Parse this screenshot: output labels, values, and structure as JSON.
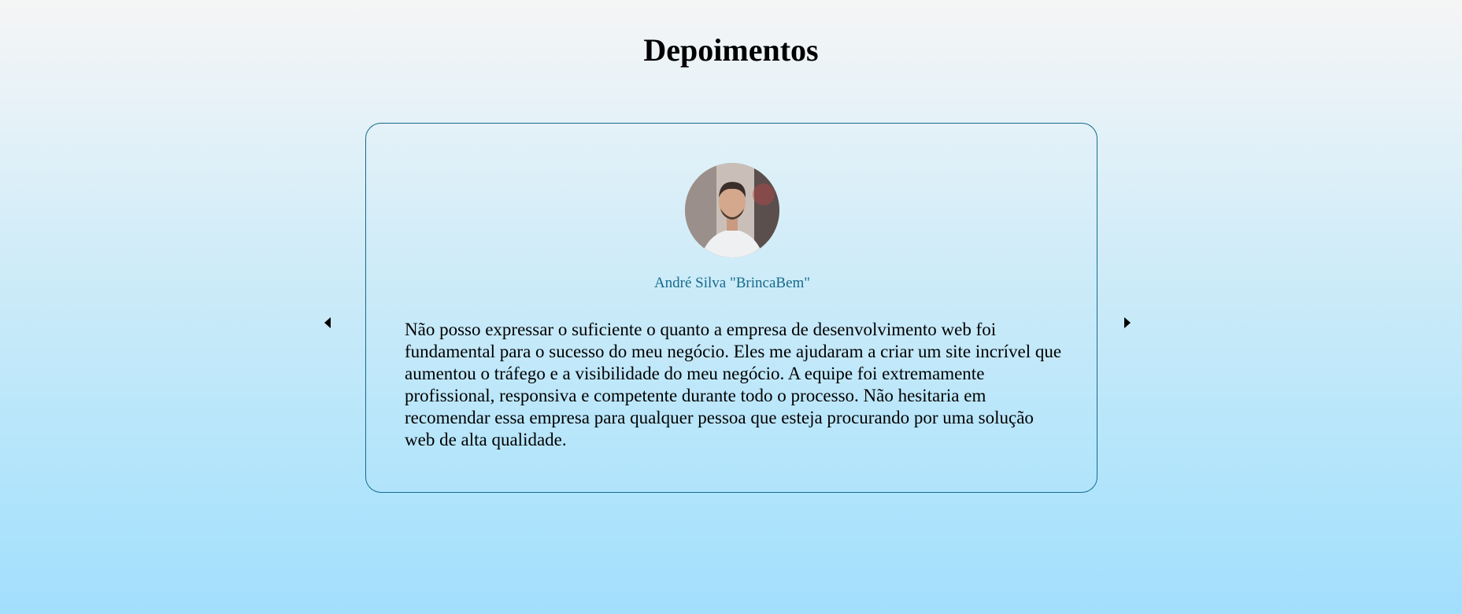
{
  "page": {
    "title": "Depoimentos"
  },
  "testimonial": {
    "author": "André Silva \"BrincaBem\"",
    "quote": "Não posso expressar o suficiente o quanto a empresa de desenvolvimento web foi fundamental para o sucesso do meu negócio. Eles me ajudaram a criar um site incrível que aumentou o tráfego e a visibilidade do meu negócio. A equipe foi extremamente profissional, responsiva e competente durante todo o processo. Não hesitaria em recomendar essa empresa para qualquer pessoa que esteja procurando por uma solução web de alta qualidade."
  },
  "controls": {
    "prev_icon": "caret-left-icon",
    "next_icon": "caret-right-icon"
  },
  "colors": {
    "accent": "#156b8c",
    "background_top": "#f5f5f5",
    "background_bottom": "#a2dffd"
  }
}
